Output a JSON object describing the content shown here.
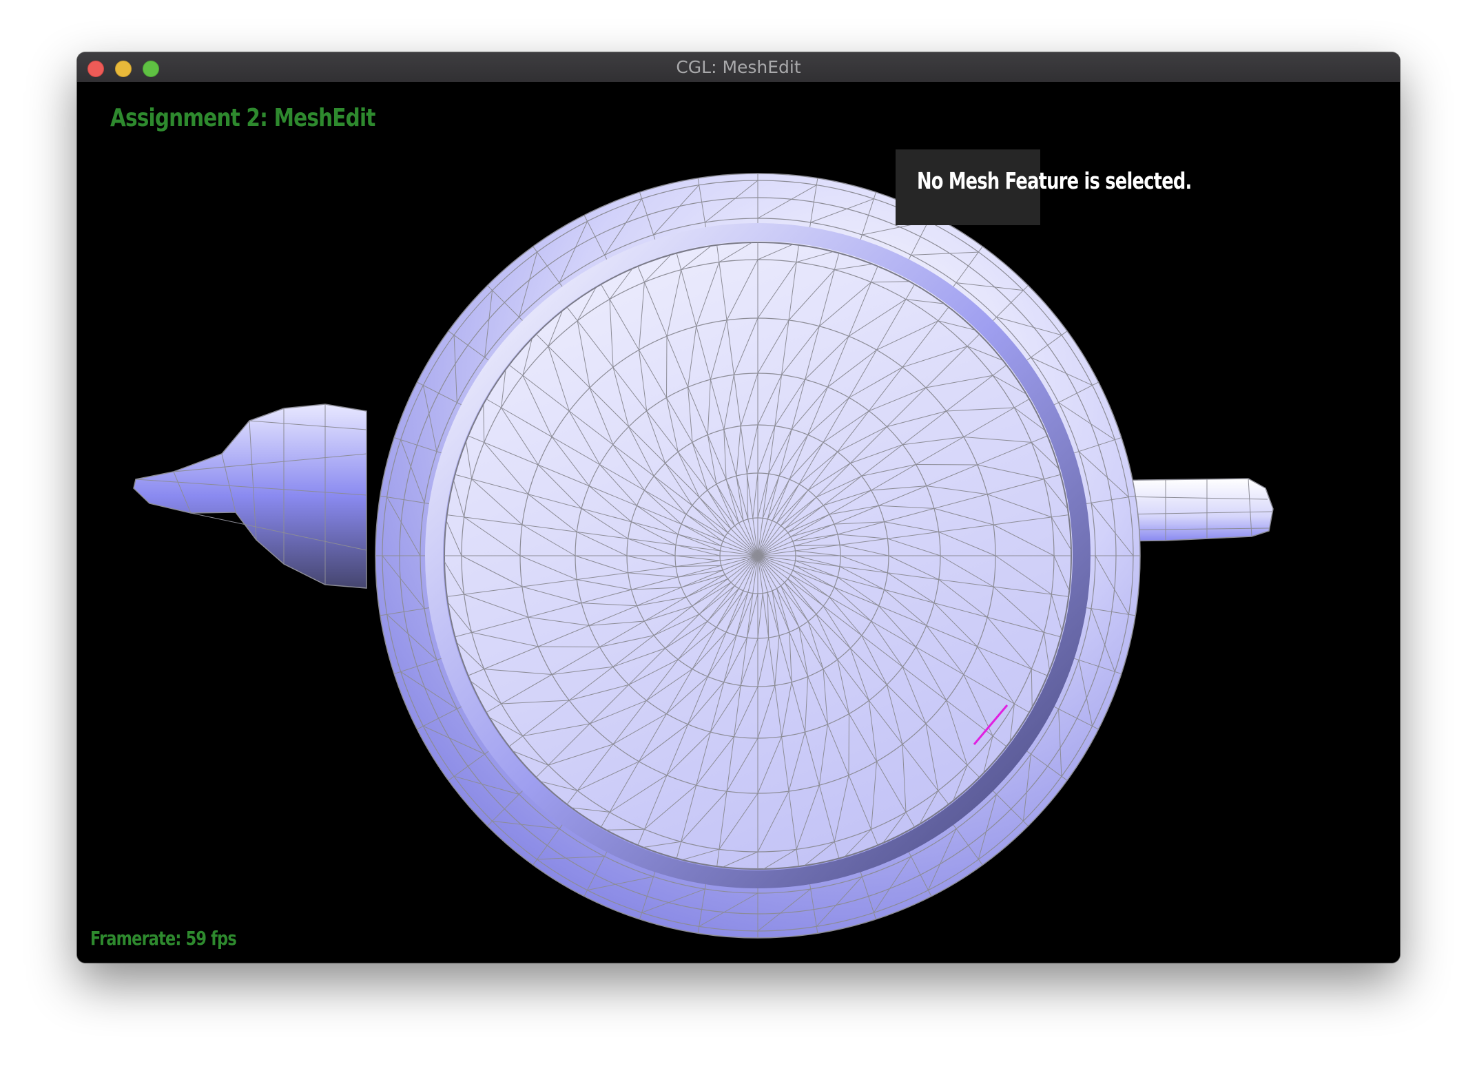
{
  "window": {
    "title": "CGL: MeshEdit",
    "controls": [
      "close",
      "minimize",
      "maximize"
    ]
  },
  "hud": {
    "title": "Assignment 2: MeshEdit",
    "message": "No Mesh Feature is selected.",
    "framerate": "Framerate: 59 fps"
  },
  "scene": {
    "model": "teapot-top-view-icon",
    "fill_color": "#b8b8ff",
    "wire_color": "#8c8c96",
    "highlight_edge_color": "#e020e0",
    "background_color": "#000000",
    "title_color": "#2e8a2e"
  }
}
